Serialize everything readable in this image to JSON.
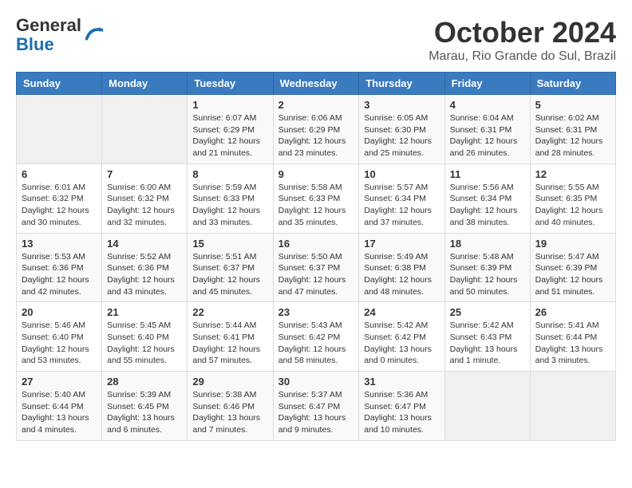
{
  "header": {
    "logo_line1": "General",
    "logo_line2": "Blue",
    "title": "October 2024",
    "subtitle": "Marau, Rio Grande do Sul, Brazil"
  },
  "columns": [
    "Sunday",
    "Monday",
    "Tuesday",
    "Wednesday",
    "Thursday",
    "Friday",
    "Saturday"
  ],
  "weeks": [
    [
      {
        "day": "",
        "info": ""
      },
      {
        "day": "",
        "info": ""
      },
      {
        "day": "1",
        "info": "Sunrise: 6:07 AM\nSunset: 6:29 PM\nDaylight: 12 hours and 21 minutes."
      },
      {
        "day": "2",
        "info": "Sunrise: 6:06 AM\nSunset: 6:29 PM\nDaylight: 12 hours and 23 minutes."
      },
      {
        "day": "3",
        "info": "Sunrise: 6:05 AM\nSunset: 6:30 PM\nDaylight: 12 hours and 25 minutes."
      },
      {
        "day": "4",
        "info": "Sunrise: 6:04 AM\nSunset: 6:31 PM\nDaylight: 12 hours and 26 minutes."
      },
      {
        "day": "5",
        "info": "Sunrise: 6:02 AM\nSunset: 6:31 PM\nDaylight: 12 hours and 28 minutes."
      }
    ],
    [
      {
        "day": "6",
        "info": "Sunrise: 6:01 AM\nSunset: 6:32 PM\nDaylight: 12 hours and 30 minutes."
      },
      {
        "day": "7",
        "info": "Sunrise: 6:00 AM\nSunset: 6:32 PM\nDaylight: 12 hours and 32 minutes."
      },
      {
        "day": "8",
        "info": "Sunrise: 5:59 AM\nSunset: 6:33 PM\nDaylight: 12 hours and 33 minutes."
      },
      {
        "day": "9",
        "info": "Sunrise: 5:58 AM\nSunset: 6:33 PM\nDaylight: 12 hours and 35 minutes."
      },
      {
        "day": "10",
        "info": "Sunrise: 5:57 AM\nSunset: 6:34 PM\nDaylight: 12 hours and 37 minutes."
      },
      {
        "day": "11",
        "info": "Sunrise: 5:56 AM\nSunset: 6:34 PM\nDaylight: 12 hours and 38 minutes."
      },
      {
        "day": "12",
        "info": "Sunrise: 5:55 AM\nSunset: 6:35 PM\nDaylight: 12 hours and 40 minutes."
      }
    ],
    [
      {
        "day": "13",
        "info": "Sunrise: 5:53 AM\nSunset: 6:36 PM\nDaylight: 12 hours and 42 minutes."
      },
      {
        "day": "14",
        "info": "Sunrise: 5:52 AM\nSunset: 6:36 PM\nDaylight: 12 hours and 43 minutes."
      },
      {
        "day": "15",
        "info": "Sunrise: 5:51 AM\nSunset: 6:37 PM\nDaylight: 12 hours and 45 minutes."
      },
      {
        "day": "16",
        "info": "Sunrise: 5:50 AM\nSunset: 6:37 PM\nDaylight: 12 hours and 47 minutes."
      },
      {
        "day": "17",
        "info": "Sunrise: 5:49 AM\nSunset: 6:38 PM\nDaylight: 12 hours and 48 minutes."
      },
      {
        "day": "18",
        "info": "Sunrise: 5:48 AM\nSunset: 6:39 PM\nDaylight: 12 hours and 50 minutes."
      },
      {
        "day": "19",
        "info": "Sunrise: 5:47 AM\nSunset: 6:39 PM\nDaylight: 12 hours and 51 minutes."
      }
    ],
    [
      {
        "day": "20",
        "info": "Sunrise: 5:46 AM\nSunset: 6:40 PM\nDaylight: 12 hours and 53 minutes."
      },
      {
        "day": "21",
        "info": "Sunrise: 5:45 AM\nSunset: 6:40 PM\nDaylight: 12 hours and 55 minutes."
      },
      {
        "day": "22",
        "info": "Sunrise: 5:44 AM\nSunset: 6:41 PM\nDaylight: 12 hours and 57 minutes."
      },
      {
        "day": "23",
        "info": "Sunrise: 5:43 AM\nSunset: 6:42 PM\nDaylight: 12 hours and 58 minutes."
      },
      {
        "day": "24",
        "info": "Sunrise: 5:42 AM\nSunset: 6:42 PM\nDaylight: 13 hours and 0 minutes."
      },
      {
        "day": "25",
        "info": "Sunrise: 5:42 AM\nSunset: 6:43 PM\nDaylight: 13 hours and 1 minute."
      },
      {
        "day": "26",
        "info": "Sunrise: 5:41 AM\nSunset: 6:44 PM\nDaylight: 13 hours and 3 minutes."
      }
    ],
    [
      {
        "day": "27",
        "info": "Sunrise: 5:40 AM\nSunset: 6:44 PM\nDaylight: 13 hours and 4 minutes."
      },
      {
        "day": "28",
        "info": "Sunrise: 5:39 AM\nSunset: 6:45 PM\nDaylight: 13 hours and 6 minutes."
      },
      {
        "day": "29",
        "info": "Sunrise: 5:38 AM\nSunset: 6:46 PM\nDaylight: 13 hours and 7 minutes."
      },
      {
        "day": "30",
        "info": "Sunrise: 5:37 AM\nSunset: 6:47 PM\nDaylight: 13 hours and 9 minutes."
      },
      {
        "day": "31",
        "info": "Sunrise: 5:36 AM\nSunset: 6:47 PM\nDaylight: 13 hours and 10 minutes."
      },
      {
        "day": "",
        "info": ""
      },
      {
        "day": "",
        "info": ""
      }
    ]
  ]
}
